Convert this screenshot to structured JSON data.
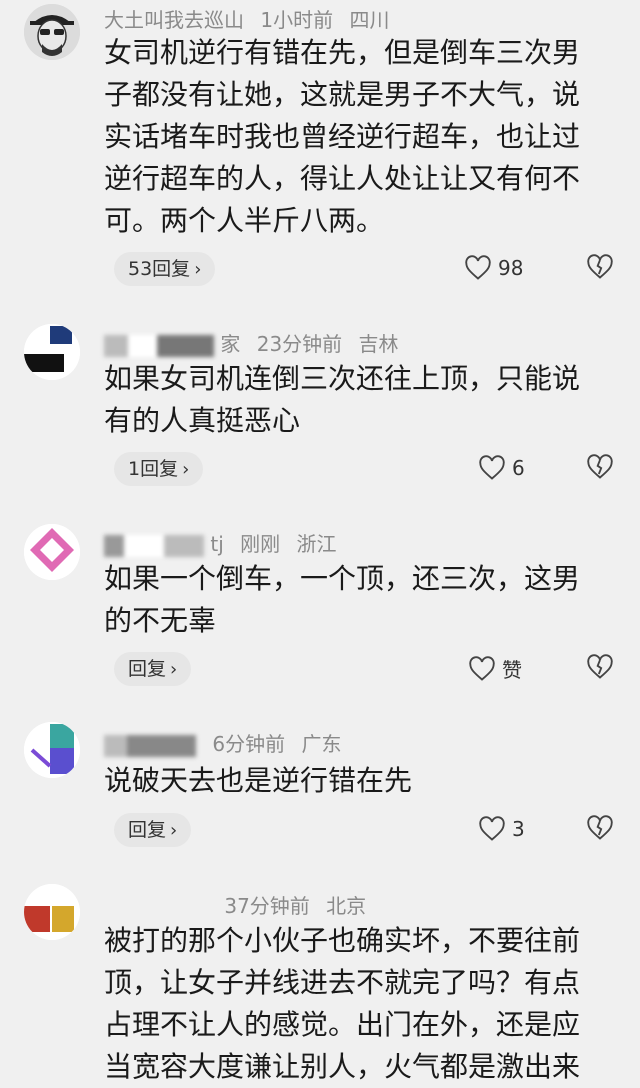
{
  "comments": [
    {
      "user": "大土叫我去巡山",
      "time": "1小时前",
      "location": "四川",
      "text": "女司机逆行有错在先，但是倒车三次男子都没有让她，这就是男子不大气，说实话堵车时我也曾经逆行超车，也让过逆行超车的人，得让人处让让又有何不可。两个人半斤八两。",
      "reply_label": "53回复",
      "likes": "98"
    },
    {
      "user": "家",
      "time": "23分钟前",
      "location": "吉林",
      "text": "如果女司机连倒三次还往上顶，只能说有的人真挺恶心",
      "reply_label": "1回复",
      "likes": "6"
    },
    {
      "user": "tj",
      "time": "刚刚",
      "location": "浙江",
      "text": "如果一个倒车，一个顶，还三次，这男的不无辜",
      "reply_label": "回复",
      "likes": "赞"
    },
    {
      "user": "",
      "time": "6分钟前",
      "location": "广东",
      "text": "说破天去也是逆行错在先",
      "reply_label": "回复",
      "likes": "3"
    },
    {
      "user": "",
      "time": "37分钟前",
      "location": "北京",
      "text": "被打的那个小伙子也确实坏，不要往前顶，让女子并线进去不就完了吗？有点占理不让人的感觉。出门在外，还是应当宽容大度谦让别人，火气都是激出来"
    }
  ],
  "icons": {
    "reply_chevron": "›",
    "like": "heart-outline-icon",
    "dislike": "broken-heart-icon"
  }
}
